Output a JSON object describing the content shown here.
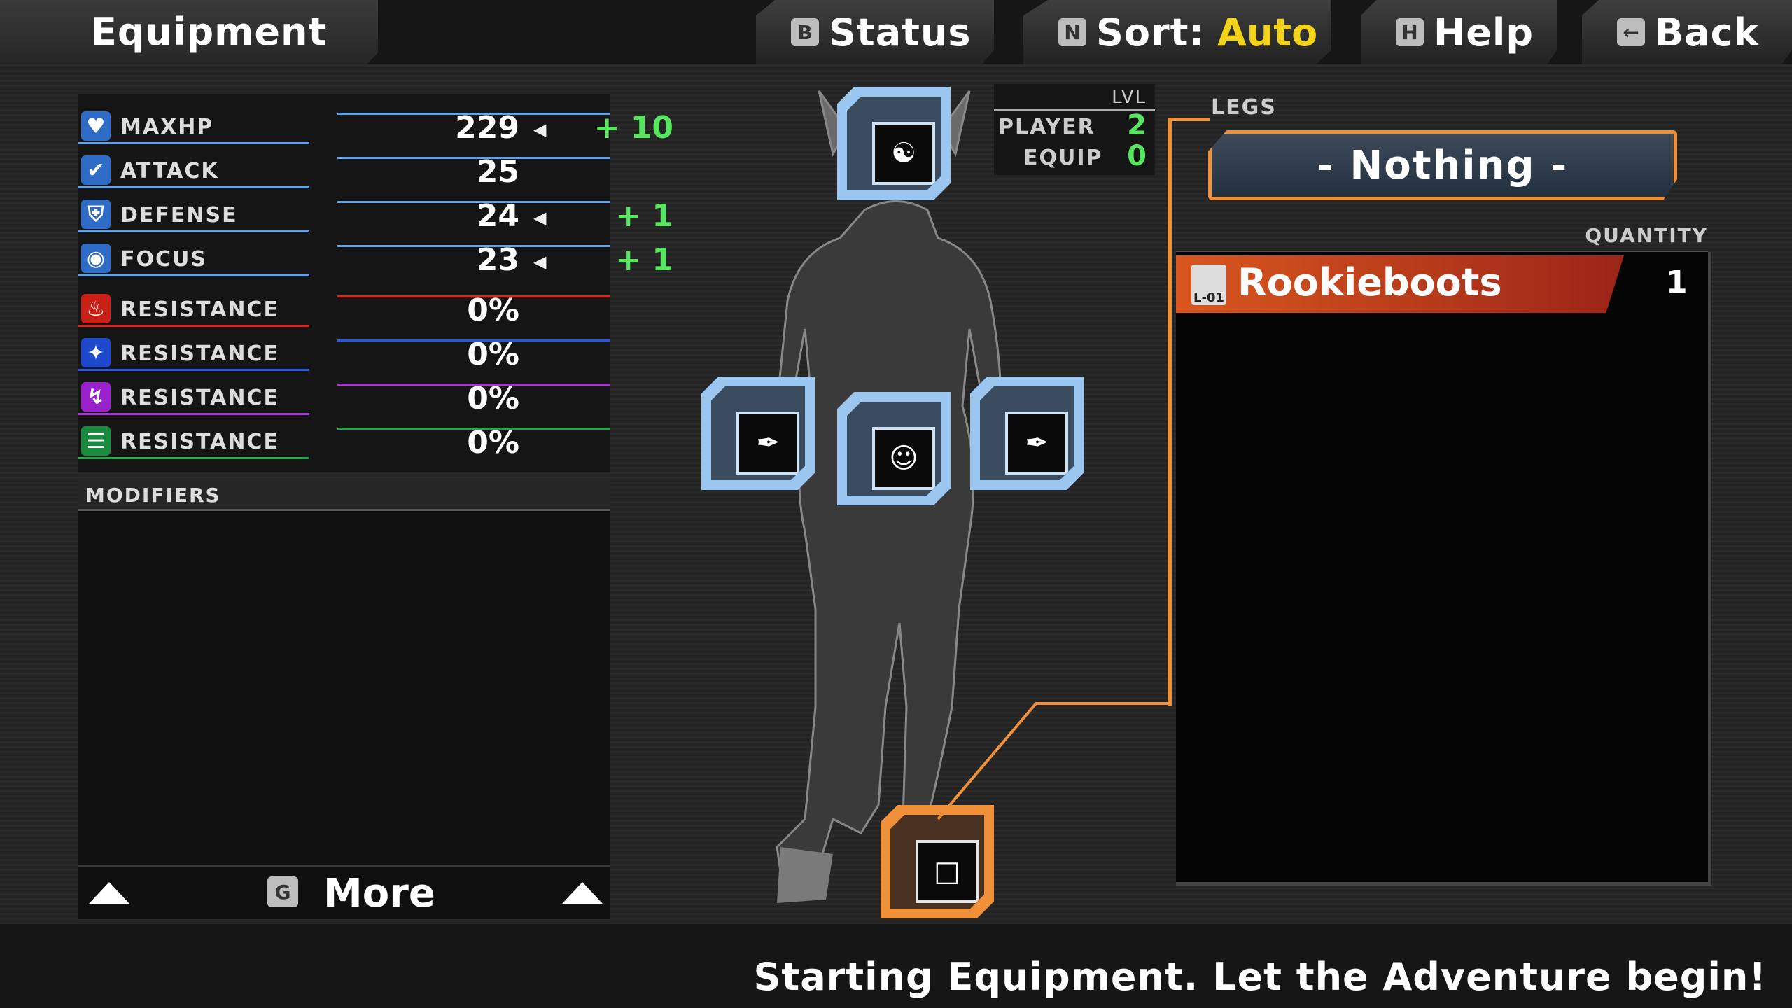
{
  "header": {
    "title": "Equipment",
    "buttons": [
      {
        "key": "B",
        "label": "Status"
      },
      {
        "key": "N",
        "label": "Sort:",
        "value": "Auto"
      },
      {
        "key": "H",
        "label": "Help"
      },
      {
        "key": "←",
        "label": "Back"
      }
    ]
  },
  "stats": [
    {
      "name": "MAXHP",
      "value": "229",
      "bonus": "+ 10",
      "color": "#5aa4f0"
    },
    {
      "name": "ATTACK",
      "value": "25",
      "bonus": "",
      "color": "#5aa4f0"
    },
    {
      "name": "DEFENSE",
      "value": "24",
      "bonus": "+ 1",
      "color": "#5aa4f0"
    },
    {
      "name": "FOCUS",
      "value": "23",
      "bonus": "+ 1",
      "color": "#5aa4f0"
    },
    {
      "name": "RESISTANCE",
      "value": "0%",
      "bonus": "",
      "color": "#e0241a"
    },
    {
      "name": "RESISTANCE",
      "value": "0%",
      "bonus": "",
      "color": "#2456e8"
    },
    {
      "name": "RESISTANCE",
      "value": "0%",
      "bonus": "",
      "color": "#b02ee0"
    },
    {
      "name": "RESISTANCE",
      "value": "0%",
      "bonus": "",
      "color": "#1fa84a"
    }
  ],
  "modifiers": {
    "title": "MODIFIERS",
    "more_key": "G",
    "more_label": "More"
  },
  "level": {
    "header": "LVL",
    "player_label": "PLAYER",
    "player_value": "2",
    "equip_label": "EQUIP",
    "equip_value": "0"
  },
  "legs_panel": {
    "slot_label": "LEGS",
    "equipped": "- Nothing -",
    "quantity_header": "QUANTITY",
    "items": [
      {
        "name": "Rookieboots",
        "icon_label": "L-01",
        "quantity": "1"
      }
    ]
  },
  "footer_text": "Starting Equipment. Let the Adventure begin!",
  "colors": {
    "accent": "#f0913a",
    "bonus": "#56e660",
    "sort_value": "#f2d31a"
  }
}
